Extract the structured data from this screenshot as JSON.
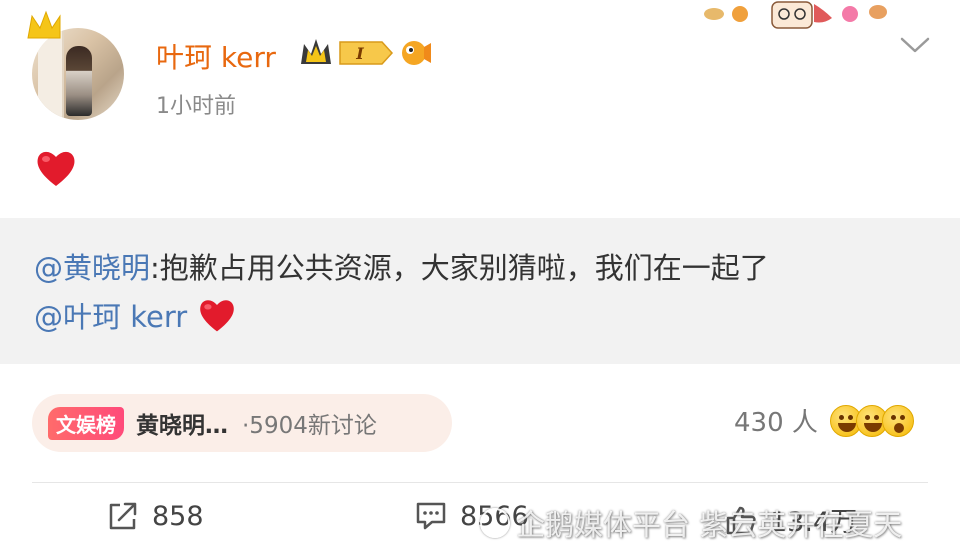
{
  "post": {
    "username": "叶珂 kerr",
    "level_badge": "I",
    "timestamp": "1小时前",
    "body_icon": "red-heart",
    "quote": {
      "mention": "@黄晓明",
      "text": ":抱歉占用公共资源，大家别猜啦，我们在一起了",
      "mention2": "@叶珂 kerr",
      "heart_icon": "red-heart"
    }
  },
  "topic": {
    "tag": "文娱榜",
    "title": "黄晓明…",
    "count": "·5904新讨论"
  },
  "reactions": {
    "count": "430 人",
    "emoji_icons": [
      "grin-emoji",
      "laugh-emoji",
      "surprised-emoji"
    ]
  },
  "actions": {
    "share": "858",
    "comment": "8566",
    "like": "13.4万"
  },
  "watermark": {
    "text": "企鹅媒体平台 紫云英开在夏天"
  },
  "colors": {
    "username": "#e8680f",
    "mention": "#4a78b5",
    "quote_bg": "#f2f2f2",
    "topic_bg": "#fbeee8"
  }
}
